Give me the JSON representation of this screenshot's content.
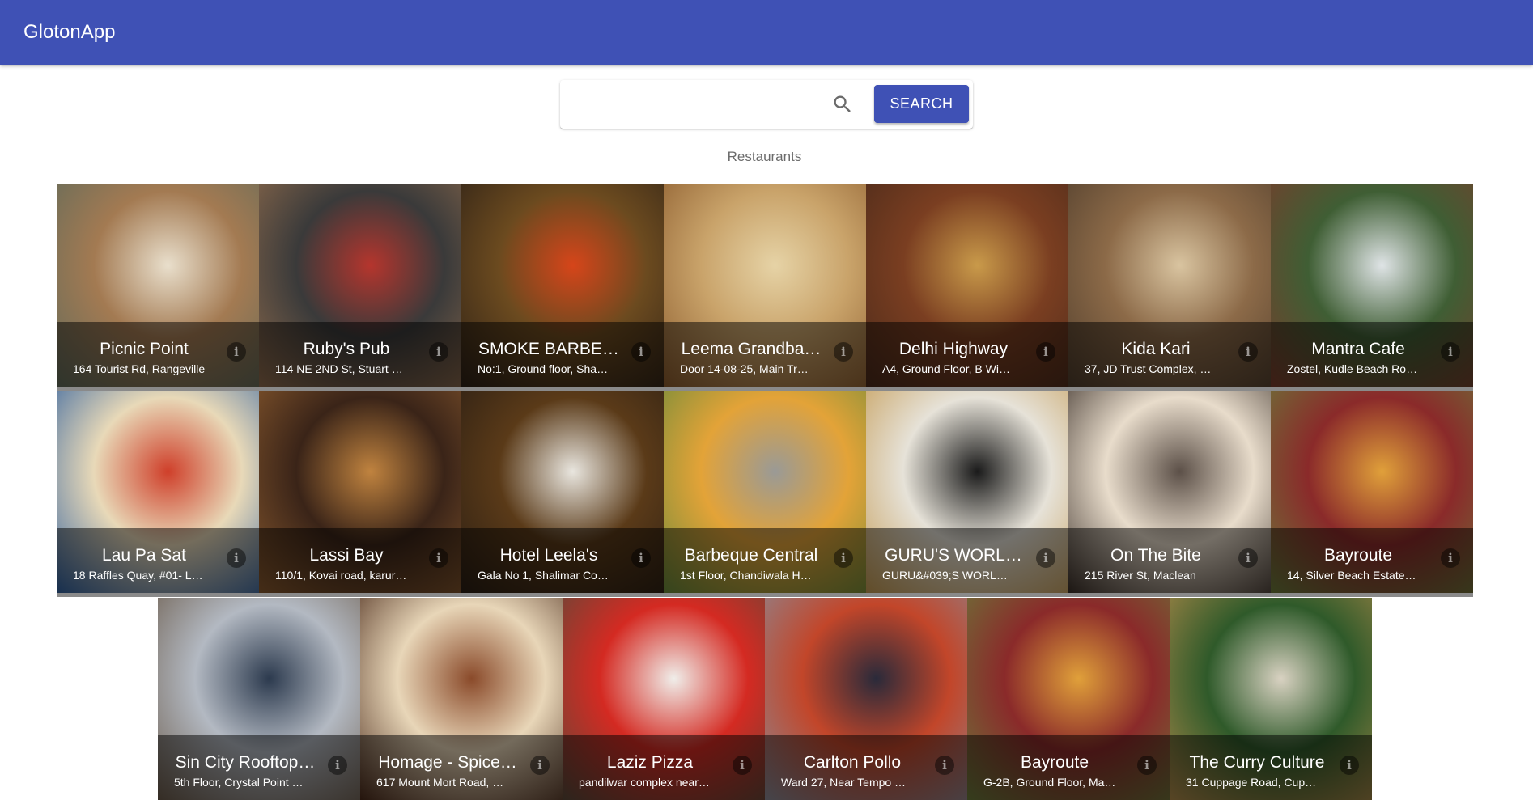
{
  "app": {
    "title": "GlotonApp"
  },
  "colors": {
    "primary": "#3f51b5"
  },
  "search": {
    "placeholder": "",
    "value": "",
    "button_label": "SEARCH",
    "icon": "search-icon"
  },
  "section": {
    "title": "Restaurants"
  },
  "restaurants": [
    {
      "name": "Picnic Point",
      "address": "164 Tourist Rd, Rangeville",
      "image_colors": [
        "#e9dfcc",
        "#a37a52",
        "#5f6a5a"
      ]
    },
    {
      "name": "Ruby's Pub",
      "address": "114 NE 2ND St, Stuart …",
      "image_colors": [
        "#b5352d",
        "#3a3a3a",
        "#8f6b4c"
      ]
    },
    {
      "name": "SMOKE BARBE…",
      "address": "No:1, Ground floor, Sha…",
      "image_colors": [
        "#d6451a",
        "#6b4a1f",
        "#2c2016"
      ]
    },
    {
      "name": "Leema Grandba…",
      "address": "Door 14-08-25, Main Tr…",
      "image_colors": [
        "#e6d3a6",
        "#c9a36a",
        "#8a5a2c"
      ]
    },
    {
      "name": "Delhi Highway",
      "address": "A4, Ground Floor, B Wi…",
      "image_colors": [
        "#c99a4a",
        "#7a3e21",
        "#4a2a1a"
      ]
    },
    {
      "name": "Kida Kari",
      "address": "37, JD Trust Complex, …",
      "image_colors": [
        "#d9c4a0",
        "#8c6a48",
        "#4f3d2c"
      ]
    },
    {
      "name": "Mantra Cafe",
      "address": "Zostel, Kudle Beach Ro…",
      "image_colors": [
        "#dfe4e6",
        "#3f5e34",
        "#7a3c2c"
      ]
    },
    {
      "name": "Lau Pa Sat",
      "address": "18 Raffles Quay, #01- L…",
      "image_colors": [
        "#cf3f2a",
        "#e8d9b8",
        "#2f5f9e"
      ]
    },
    {
      "name": "Lassi Bay",
      "address": "110/1, Kovai road, karur…",
      "image_colors": [
        "#c0833f",
        "#3a2418",
        "#8a5a2e"
      ]
    },
    {
      "name": "Hotel Leela's",
      "address": "Gala No 1, Shalimar Co…",
      "image_colors": [
        "#e9e6df",
        "#5a3a18",
        "#2a1e14"
      ]
    },
    {
      "name": "Barbeque Central",
      "address": "1st Floor, Chandiwala H…",
      "image_colors": [
        "#9a9a96",
        "#e3a338",
        "#6a8a3a"
      ]
    },
    {
      "name": "GURU'S WORL…",
      "address": "GURU&#039;S WORL…",
      "image_colors": [
        "#1a1a1a",
        "#e6e2d8",
        "#c49a52"
      ]
    },
    {
      "name": "On The Bite",
      "address": "215 River St, Maclean",
      "image_colors": [
        "#5c5048",
        "#e8dccb",
        "#3a2f28"
      ]
    },
    {
      "name": "Bayroute",
      "address": "14, Silver Beach Estate…",
      "image_colors": [
        "#e0a03a",
        "#8a2a2a",
        "#6a7a3a"
      ]
    },
    {
      "name": "Sin City Rooftop…",
      "address": "5th Floor, Crystal Point …",
      "image_colors": [
        "#2c3a4e",
        "#b3b9c2",
        "#6a5a4a"
      ]
    },
    {
      "name": "Homage - Spice…",
      "address": "617 Mount Mort Road, …",
      "image_colors": [
        "#8a4a2a",
        "#e8d6b8",
        "#4a2a1a"
      ]
    },
    {
      "name": "Laziz Pizza",
      "address": "pandilwar complex near…",
      "image_colors": [
        "#f0eeea",
        "#d42a22",
        "#5a4a3a"
      ]
    },
    {
      "name": "Carlton Pollo",
      "address": "Ward 27, Near Tempo …",
      "image_colors": [
        "#2a2a3a",
        "#c2462a",
        "#8a8a96"
      ]
    },
    {
      "name": "Bayroute",
      "address": "G-2B, Ground Floor, Ma…",
      "image_colors": [
        "#e0a03a",
        "#8a2a2a",
        "#6a7a3a"
      ]
    },
    {
      "name": "The Curry Culture",
      "address": "31 Cuppage Road, Cup…",
      "image_colors": [
        "#d9d2c2",
        "#2f5a2a",
        "#b08a4a"
      ]
    }
  ]
}
